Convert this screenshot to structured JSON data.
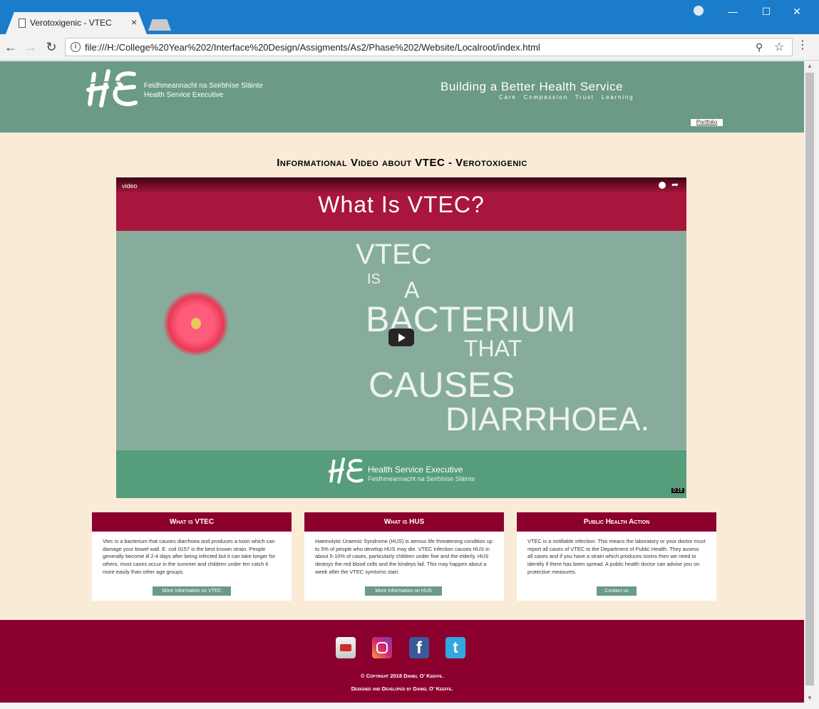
{
  "browser": {
    "tab_title": "Verotoxigenic - VTEC",
    "tab_close": "×",
    "url": "file:///H:/College%20Year%202/Interface%20Design/Assigments/As2/Phase%202/Website/Localroot/index.html",
    "back": "←",
    "forward": "→",
    "reload": "↻",
    "minimize": "—",
    "maximize": "☐",
    "close": "✕",
    "zoom": "⚲",
    "star": "☆",
    "menu": "⋮",
    "info": "i"
  },
  "header": {
    "org_irish": "Feidhmeannacht na Seirbhíse Sláinte",
    "org_english": "Health Service Executive",
    "slogan": "Building a Better Health Service",
    "slogan_sub": "Care Compassion Trust Learning",
    "portfolio_link": "Portfolio",
    "brand_color": "#6b9a85"
  },
  "main": {
    "heading": "Informational Video about VTEC - Verotoxigenic",
    "video": {
      "label": "video",
      "title": "What Is VTEC?",
      "lines": [
        "VTEC",
        "IS",
        "A",
        "BACTERIUM",
        "THAT",
        "CAUSES",
        "DIARRHOEA."
      ],
      "footer_title": "Health Service Executive",
      "footer_subtitle": "Feidhmeannacht na Seirbhíse Sláinte",
      "duration": "0:19",
      "share": "➦"
    }
  },
  "cards": [
    {
      "title": "What is VTEC",
      "body": "Vtec is a bacterium that causes diarrhoea and produces a toxin which can damage your bowel wall. E. coli 0157 is the best known strain. People generally become ill 2-4 days after being infected but it can take longer for others. most cases occur in the summer and children under ten catch it more easily than other age groups.",
      "button": "More Information on VTEC"
    },
    {
      "title": "What is HUS",
      "body": "Haemolytic Uraemic Syndrome (HUS) is aerous life threatening condition up to 5% of people who develop HUS may die. VTEC infection causes HUS in about 5-10% of cases, particularly children under five and the elderly. HUS destoys the red blood cells and the kindeys fail. This may happen about a week after the VTEC symtoms start.",
      "button": "More Information on HUS"
    },
    {
      "title": "Public Health Action",
      "body": "VTEC is a notifiable infection. This means the laboratory or your doctor must report all cases of VTEC to the Department of Public Health. They assess all cases and if you have a strain which produces toxins then we need to identify if there has been spread. A public health doctor can advise you on protective measures.",
      "button": "Contact us"
    }
  ],
  "footer": {
    "facebook_glyph": "f",
    "twitter_glyph": "t",
    "copyright": "© Copyright 2018 Daniel O' Keeffe.",
    "credit": "Designed and Developed by Daniel O' Keeffe.",
    "color": "#8c002e"
  }
}
